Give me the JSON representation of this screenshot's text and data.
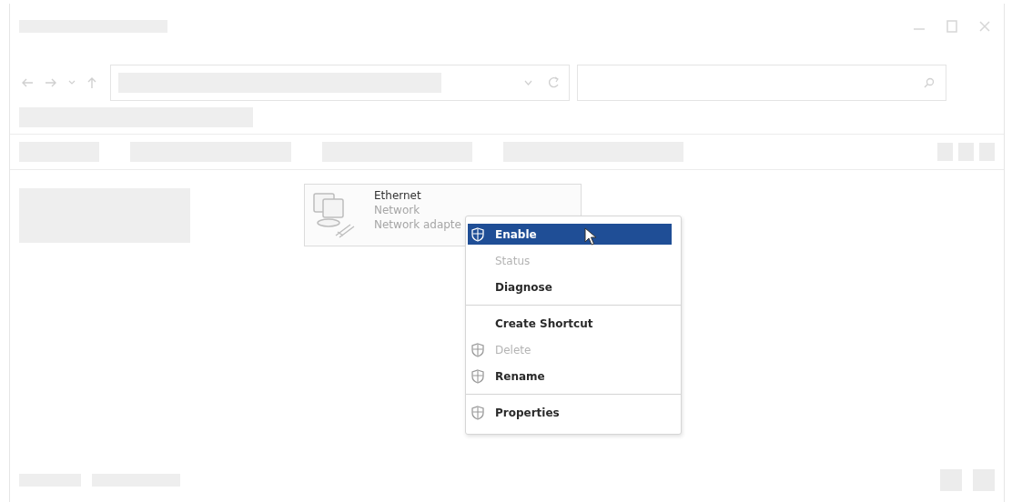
{
  "item": {
    "name": "Ethernet",
    "type": "Network",
    "description": "Network adapte"
  },
  "context_menu": [
    {
      "kind": "item",
      "label": "Enable",
      "shield": true,
      "selected": true,
      "disabled": false
    },
    {
      "kind": "item",
      "label": "Status",
      "shield": false,
      "selected": false,
      "disabled": true
    },
    {
      "kind": "item",
      "label": "Diagnose",
      "shield": false,
      "selected": false,
      "disabled": false
    },
    {
      "kind": "separator"
    },
    {
      "kind": "item",
      "label": "Create Shortcut",
      "shield": false,
      "selected": false,
      "disabled": false
    },
    {
      "kind": "item",
      "label": "Delete",
      "shield": true,
      "selected": false,
      "disabled": true
    },
    {
      "kind": "item",
      "label": "Rename",
      "shield": true,
      "selected": false,
      "disabled": false
    },
    {
      "kind": "separator"
    },
    {
      "kind": "item",
      "label": "Properties",
      "shield": true,
      "selected": false,
      "disabled": false
    }
  ]
}
